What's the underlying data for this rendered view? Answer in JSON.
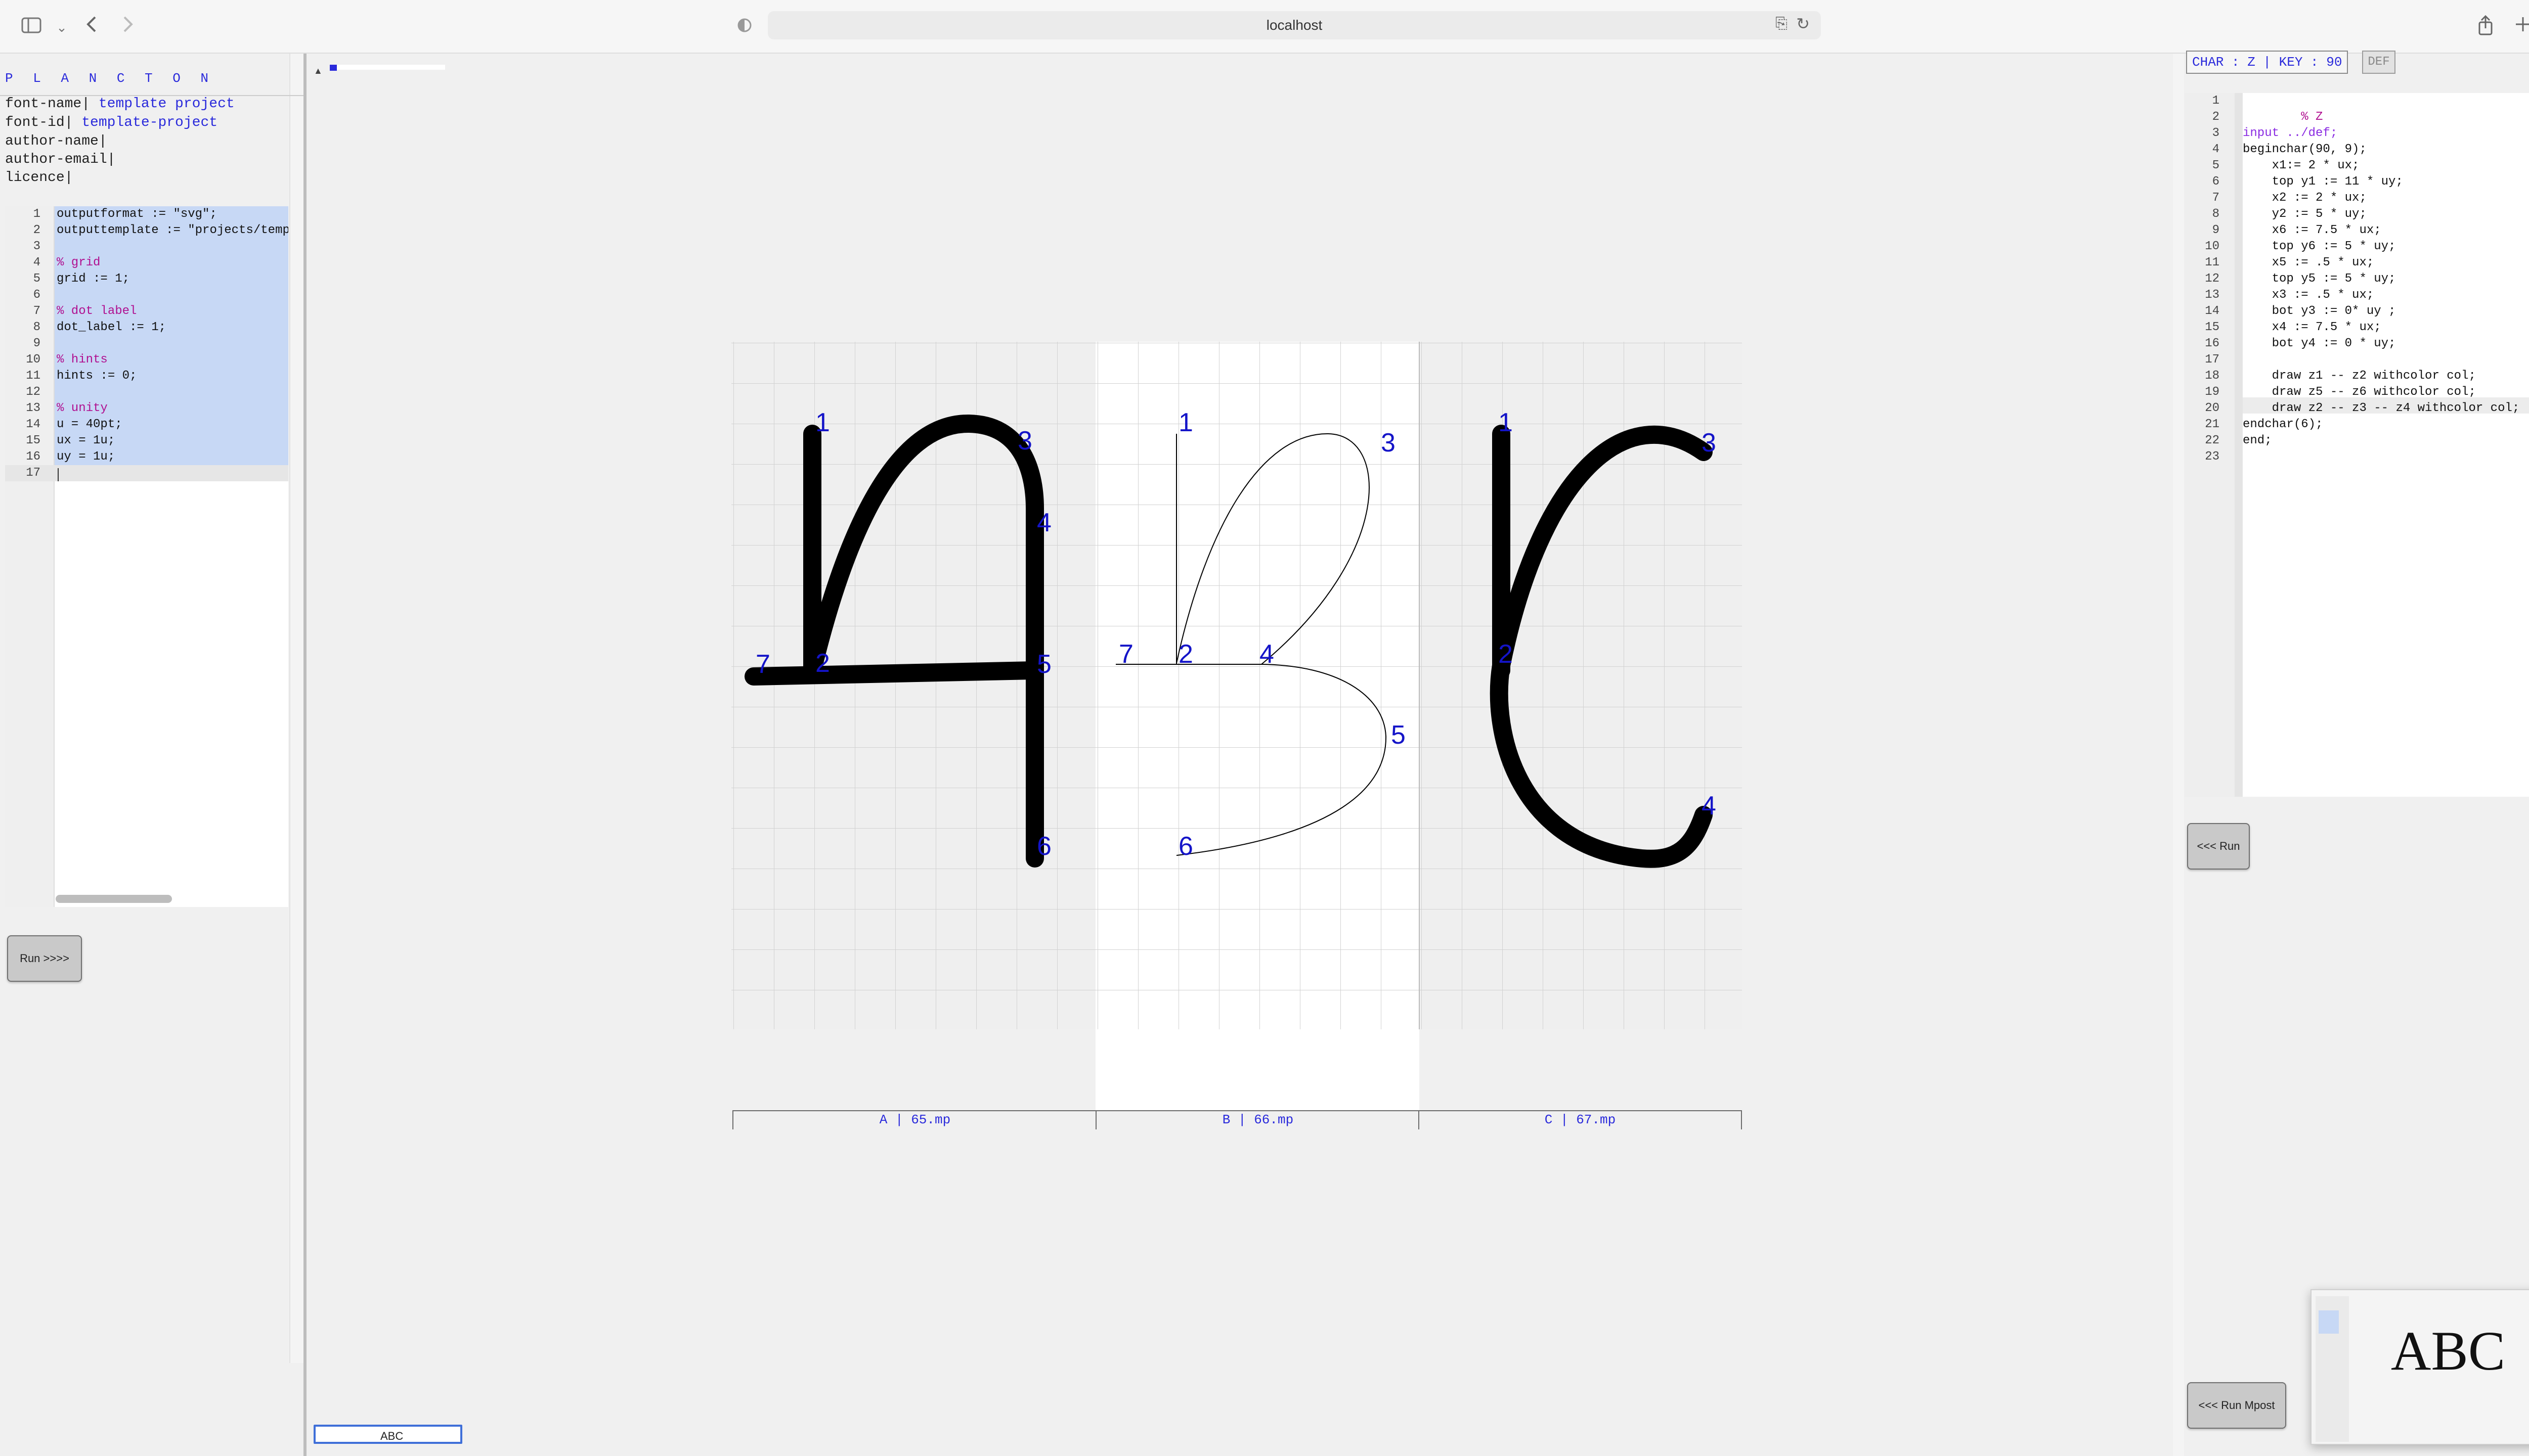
{
  "browser": {
    "url": "localhost"
  },
  "left": {
    "brand": "P L A N C T O N",
    "meta": [
      {
        "key": "font-name|",
        "value": " template project"
      },
      {
        "key": "font-id|",
        "value": " template-project"
      },
      {
        "key": "author-name|",
        "value": ""
      },
      {
        "key": "author-email|",
        "value": ""
      },
      {
        "key": "licence|",
        "value": ""
      }
    ],
    "editor_lines": [
      "outputformat := \"svg\";",
      "outputtemplate := \"projects/temp",
      "",
      "% grid",
      "grid := 1;",
      "",
      "% dot label",
      "dot_label := 1;",
      "",
      "% hints",
      "hints := 0;",
      "",
      "% unity",
      "u = 40pt;",
      "ux = 1u;",
      "uy = 1u;",
      ""
    ],
    "run_button": "Run >>>>"
  },
  "center": {
    "glyphs": [
      {
        "caption": "A | 65.mp",
        "points": [
          "1",
          "2",
          "3",
          "4",
          "5",
          "6",
          "7"
        ]
      },
      {
        "caption": "B | 66.mp",
        "points": [
          "1",
          "2",
          "3",
          "4",
          "5",
          "6",
          "7"
        ]
      },
      {
        "caption": "C | 67.mp",
        "points": [
          "1",
          "2",
          "3",
          "4"
        ]
      }
    ],
    "input_value": "ABC"
  },
  "right": {
    "char_info": "CHAR : Z | KEY : 90",
    "def_button": "DEF",
    "editor_lines": [
      "",
      "        % Z",
      "input ../def;",
      "beginchar(90, 9);",
      "    x1:= 2 * ux;",
      "    top y1 := 11 * uy;",
      "    x2 := 2 * ux;",
      "    y2 := 5 * uy;",
      "    x6 := 7.5 * ux;",
      "    top y6 := 5 * uy;",
      "    x5 := .5 * ux;",
      "    top y5 := 5 * uy;",
      "    x3 := .5 * ux;",
      "    bot y3 := 0* uy ;",
      "    x4 := 7.5 * ux;",
      "    bot y4 := 0 * uy;",
      "",
      "    draw z1 -- z2 withcolor col;",
      "    draw z5 -- z6 withcolor col;",
      "    draw z2 -- z3 -- z4 withcolor col;",
      "endchar(6);",
      "end;",
      ""
    ],
    "run_button": "<<< Run",
    "run_mpost_button": "<<< Run Mpost",
    "thumbnail_text": "ABC"
  }
}
